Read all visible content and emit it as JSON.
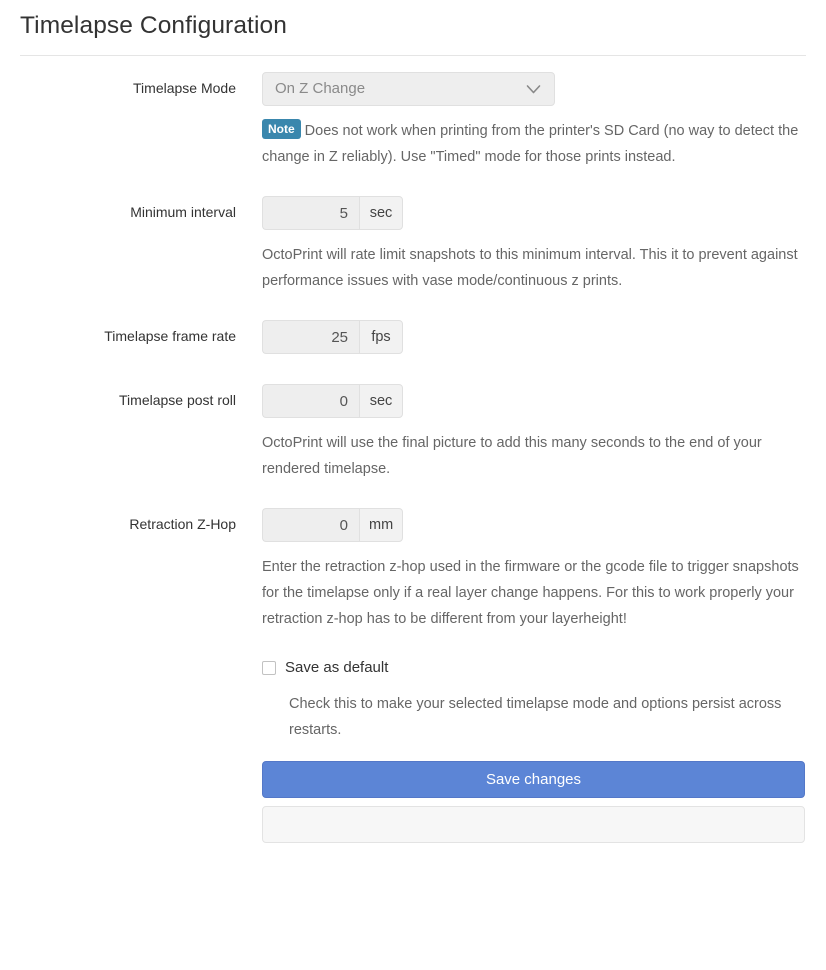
{
  "header": {
    "title": "Timelapse Configuration"
  },
  "form": {
    "mode": {
      "label": "Timelapse Mode",
      "selected_value": "On Z Change",
      "options": [
        "On Z Change"
      ],
      "chevron_icon": "chevron-down-icon",
      "note_badge": "Note",
      "note_text": "Does not work when printing from the printer's SD Card (no way to detect the change in Z reliably). Use \"Timed\" mode for those prints instead."
    },
    "minimum_interval": {
      "label": "Minimum interval",
      "value": "5",
      "unit": "sec",
      "help": "OctoPrint will rate limit snapshots to this minimum interval. This it to prevent against performance issues with vase mode/continuous z prints."
    },
    "frame_rate": {
      "label": "Timelapse frame rate",
      "value": "25",
      "unit": "fps"
    },
    "post_roll": {
      "label": "Timelapse post roll",
      "value": "0",
      "unit": "sec",
      "help": "OctoPrint will use the final picture to add this many seconds to the end of your rendered timelapse."
    },
    "retraction_zhop": {
      "label": "Retraction Z-Hop",
      "value": "0",
      "unit": "mm",
      "help": "Enter the retraction z-hop used in the firmware or the gcode file to trigger snapshots for the timelapse only if a real layer change happens. For this to work properly your retraction z-hop has to be different from your layerheight!"
    },
    "save_as_default": {
      "label": "Save as default",
      "checked": false,
      "help": "Check this to make your selected timelapse mode and options persist across restarts."
    },
    "save_button": {
      "label": "Save changes"
    }
  },
  "colors": {
    "accent_button": "#5c85d6",
    "note_badge": "#3a87ad",
    "text": "#333333",
    "help_text": "#666666",
    "control_bg": "#eeeeee",
    "border": "#e0e0e0"
  }
}
